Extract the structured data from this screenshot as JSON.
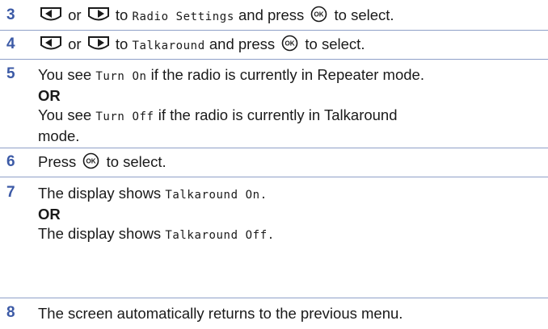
{
  "steps": [
    {
      "number": "3",
      "or": "or",
      "to": "to",
      "target": "Radio Settings",
      "press": "and press",
      "select": "to select."
    },
    {
      "number": "4",
      "or": "or",
      "to": "to",
      "target": "Talkaround",
      "press": "and press",
      "select": "to select."
    },
    {
      "number": "5",
      "line1_a": "You see",
      "line1_code": "Turn On",
      "line1_b": "if the radio is currently in Repeater mode.",
      "or": "OR",
      "line2_a": "You see",
      "line2_code": "Turn Off",
      "line2_b": "if the radio is currently in Talkaround",
      "line3": "mode."
    },
    {
      "number": "6",
      "press": "Press",
      "select": "to select."
    },
    {
      "number": "7",
      "line1_a": "The display shows",
      "line1_code": "Talkaround On.",
      "or": "OR",
      "line2_a": "The display shows",
      "line2_code": "Talkaround Off."
    },
    {
      "number": "8",
      "text": "The screen automatically returns to the previous menu."
    }
  ],
  "icons": {
    "left_key": "left-arrow-key-icon",
    "right_key": "right-arrow-key-icon",
    "ok_key": "ok-button-icon"
  },
  "colors": {
    "step_number": "#3c5aa6",
    "divider": "#8fa0c8"
  }
}
